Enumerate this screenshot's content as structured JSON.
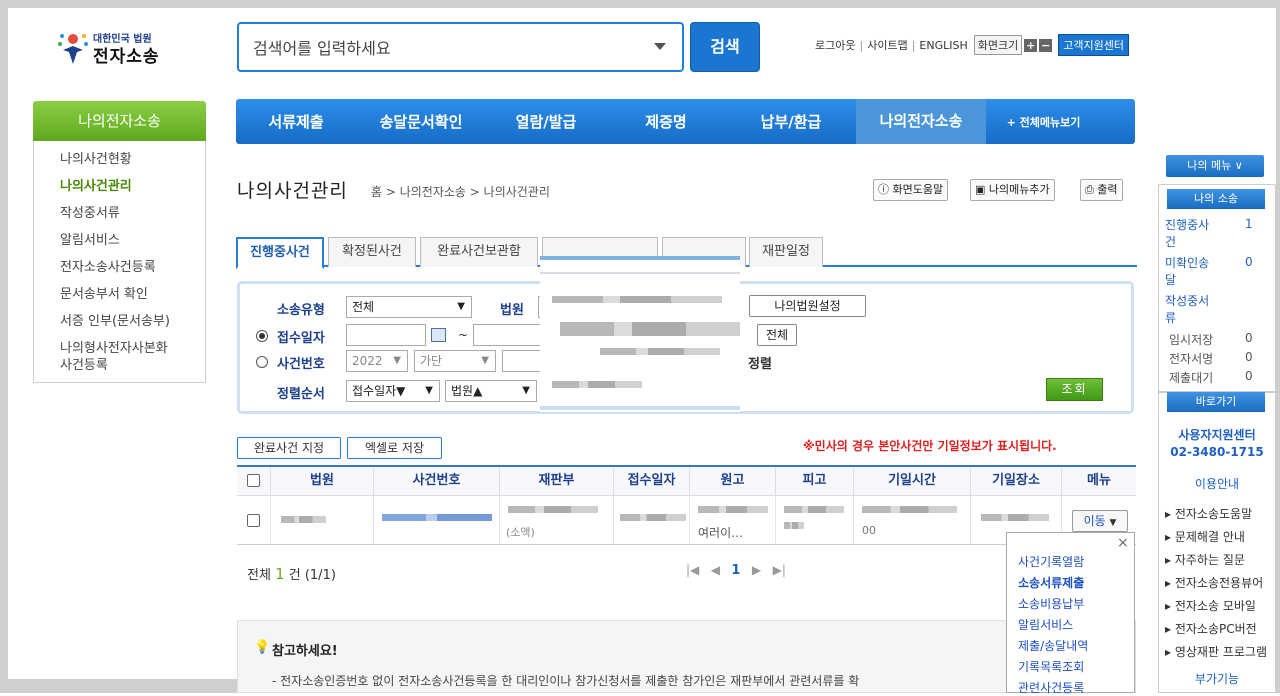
{
  "header": {
    "logo": {
      "top": "대한민국 법원",
      "main": "전자소송"
    },
    "search": {
      "placeholder": "검색어를 입력하세요",
      "button": "검색"
    },
    "util": {
      "logout": "로그아웃",
      "sitemap": "사이트맵",
      "english": "ENGLISH",
      "fontsize": "화면크기",
      "plus": "+",
      "minus": "−",
      "customer_center": "고객지원센터"
    }
  },
  "gnb": {
    "items": [
      "서류제출",
      "송달문서확인",
      "열람/발급",
      "제증명",
      "납부/환급",
      "나의전자소송"
    ],
    "all_menu": "+ 전체메뉴보기"
  },
  "lnb": {
    "title": "나의전자소송",
    "items": [
      "나의사건현황",
      "나의사건관리",
      "작성중서류",
      "알림서비스",
      "전자소송사건등록",
      "문서송부서 확인",
      "서증 인부(문서송부)",
      "나의형사전자사본화\n사건등록"
    ]
  },
  "page": {
    "title": "나의사건관리",
    "breadcrumb": "홈 > 나의전자소송 > 나의사건관리",
    "tools": {
      "help": "화면도움말",
      "add_menu": "나의메뉴추가",
      "print": "출력"
    }
  },
  "tabs": [
    "진행중사건",
    "확정된사건",
    "완료사건보관함",
    "",
    "",
    "재판일정"
  ],
  "filter": {
    "case_type_label": "소송유형",
    "case_type_value": "전체",
    "court_label": "법원",
    "my_court_btn": "나의법원설정",
    "receipt_date_label": "접수일자",
    "tilde": "~",
    "all_btn": "전체",
    "case_no_label": "사건번호",
    "year_value": "2022",
    "case_kind_value": "가단",
    "sort_text": "정렬",
    "order_label": "정렬순서",
    "order1": "접수일자▼",
    "order2": "법원▲",
    "query_btn": "조회"
  },
  "actions": {
    "mark_complete": "완료사건 지정",
    "excel": "엑셀로 저장"
  },
  "notice": "※민사의 경우 본안사건만 기일정보가 표시됩니다.",
  "table": {
    "headers": [
      "법원",
      "사건번호",
      "재판부",
      "접수일자",
      "원고",
      "피고",
      "기일시간",
      "기일장소",
      "메뉴"
    ],
    "row_cells": {
      "plaintiff_tail": "여러이…",
      "panel_tail": "(소액)",
      "time_tail": "00",
      "move_btn": "이동"
    }
  },
  "paging": {
    "total_prefix": "전체",
    "total": "1",
    "total_suffix": "건 (1/1)",
    "first": "|◀",
    "prev": "◀",
    "current": "1",
    "next": "▶",
    "last": "▶|"
  },
  "move_popup": {
    "close": "×",
    "items": [
      "사건기록열람",
      "소송서류제출",
      "소송비용납부",
      "알림서비스",
      "제출/송달내역",
      "기록목록조회",
      "관련사건등록"
    ]
  },
  "info": {
    "title": "참고하세요!",
    "text": "- 전자소송인증번호 없이 전자소송사건등록을 한 대리인이나 참가신청서를 제출한 참가인은 재판부에서 관련서류를 확"
  },
  "right": {
    "my_menu": "나의 메뉴 ∨",
    "my_suit": "나의 소송",
    "links": [
      {
        "label": "진행중사\n건",
        "count": "1"
      },
      {
        "label": "미확인송\n달",
        "count": "0"
      },
      {
        "label": "작성중서\n류",
        "count": ""
      }
    ],
    "grey": [
      {
        "label": "임시저장",
        "count": "0"
      },
      {
        "label": "전자서명",
        "count": "0"
      },
      {
        "label": "제출대기",
        "count": "0"
      }
    ],
    "shortcut": "바로가기",
    "support": "사용자지원센터",
    "phone": "02-3480-1715",
    "guide": "이용안내",
    "guide_items": [
      "전자소송도움말",
      "문제해결 안내",
      "자주하는 질문",
      "전자소송전용뷰어",
      "전자소송 모바일",
      "전자소송PC버전",
      "영상재판 프로그램"
    ],
    "extra": "부가기능"
  }
}
